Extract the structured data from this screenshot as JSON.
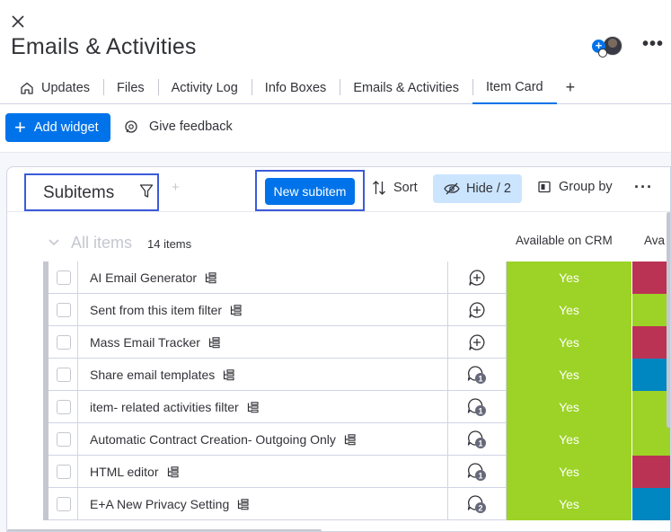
{
  "header": {
    "title": "Emails & Activities",
    "more_label": "•••"
  },
  "tabs": [
    {
      "label": "Updates"
    },
    {
      "label": "Files"
    },
    {
      "label": "Activity Log"
    },
    {
      "label": "Info Boxes"
    },
    {
      "label": "Emails & Activities"
    },
    {
      "label": "Item Card",
      "active": true
    }
  ],
  "toolbar": {
    "add_widget_label": "Add widget",
    "feedback_label": "Give feedback"
  },
  "widget": {
    "title": "Subitems",
    "new_subitem_label": "New subitem",
    "sort_label": "Sort",
    "hide_label": "Hide / 2",
    "groupby_label": "Group by",
    "group_name": "All items",
    "count_label": "14 items",
    "columns": {
      "crm": "Available on CRM",
      "ava": "Ava"
    },
    "rows": [
      {
        "name": "AI Email Generator",
        "conv": "add",
        "crm": "Yes",
        "ava_color": "#bb3354"
      },
      {
        "name": "Sent from this item filter",
        "conv": "add",
        "crm": "Yes",
        "ava_color": "#9cd326"
      },
      {
        "name": "Mass Email Tracker",
        "conv": "add",
        "crm": "Yes",
        "ava_color": "#bb3354"
      },
      {
        "name": "Share email templates",
        "conv": "1",
        "crm": "Yes",
        "ava_color": "#0086c0"
      },
      {
        "name": "item- related activities filter",
        "conv": "1",
        "crm": "Yes",
        "ava_color": "#9cd326"
      },
      {
        "name": "Automatic Contract Creation- Outgoing Only",
        "conv": "1",
        "crm": "Yes",
        "ava_color": "#9cd326"
      },
      {
        "name": "HTML editor",
        "conv": "1",
        "crm": "Yes",
        "ava_color": "#bb3354"
      },
      {
        "name": "E+A New Privacy Setting",
        "conv": "2",
        "crm": "Yes",
        "ava_color": "#0086c0"
      }
    ]
  },
  "colors": {
    "primary": "#0073ea",
    "status_green": "#9cd326",
    "status_red": "#bb3354",
    "status_blue": "#0086c0",
    "highlight_box": "#3b5bdb"
  }
}
